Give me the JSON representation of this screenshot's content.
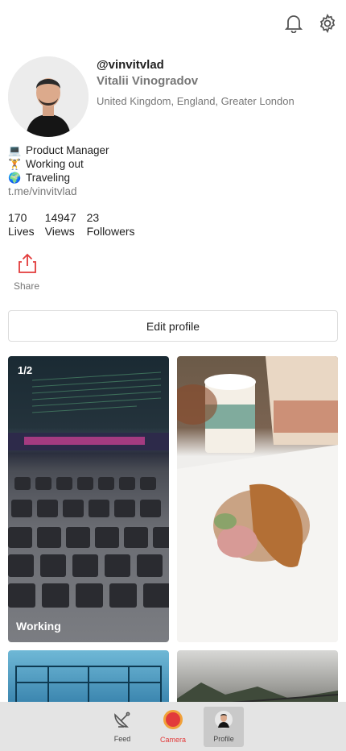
{
  "header": {
    "username": "@vinvitvlad",
    "full_name": "Vitalii Vinogradov",
    "location": "United Kingdom, England, Greater London"
  },
  "bio": {
    "lines": [
      {
        "emoji": "💻",
        "text": "Product Manager"
      },
      {
        "emoji": "🏋",
        "text": "Working out"
      },
      {
        "emoji": "🌍",
        "text": "Traveling"
      }
    ],
    "link": "t.me/vinvitvlad"
  },
  "stats": [
    {
      "value": "170",
      "label": "Lives"
    },
    {
      "value": "14947",
      "label": "Views"
    },
    {
      "value": "23",
      "label": "Followers"
    }
  ],
  "share_label": "Share",
  "edit_profile_label": "Edit profile",
  "posts": [
    {
      "count": "1/2",
      "caption": "Working"
    },
    {
      "count": "",
      "caption": ""
    },
    {
      "count": "",
      "caption": ""
    },
    {
      "count": "",
      "caption": ""
    }
  ],
  "tabs": [
    {
      "label": "Feed",
      "icon": "satellite-dish-icon"
    },
    {
      "label": "Camera",
      "icon": "record-icon"
    },
    {
      "label": "Profile",
      "icon": "avatar-icon"
    }
  ],
  "colors": {
    "accent": "#e23b3b",
    "muted_text": "#777777",
    "tabbar_bg": "#e4e4e4"
  }
}
